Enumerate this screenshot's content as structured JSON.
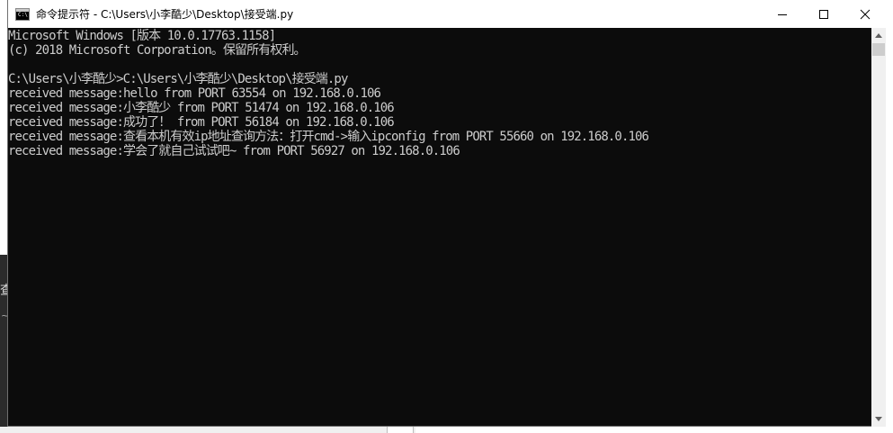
{
  "window": {
    "title": "命令提示符 - C:\\Users\\小李酷少\\Desktop\\接受端.py",
    "icon": "cmd-icon",
    "icon_text": "C:\\",
    "controls": [
      "minimize-icon",
      "maximize-icon",
      "close-icon"
    ]
  },
  "console": {
    "background": "#0c0c0c",
    "foreground": "#cccccc",
    "lines": [
      "Microsoft Windows [版本 10.0.17763.1158]",
      "(c) 2018 Microsoft Corporation。保留所有权利。",
      "",
      "C:\\Users\\小李酷少>C:\\Users\\小李酷少\\Desktop\\接受端.py",
      "received message:hello from PORT 63554 on 192.168.0.106",
      "received message:小李酷少 from PORT 51474 on 192.168.0.106",
      "received message:成功了！ from PORT 56184 on 192.168.0.106",
      "received message:查看本机有效ip地址查询方法：打开cmd->输入ipconfig from PORT 55660 on 192.168.0.106",
      "received message:学会了就自己试试吧~ from PORT 56927 on 192.168.0.106"
    ]
  },
  "background": {
    "left_glyph": "查",
    "left_glyph2": "~"
  }
}
